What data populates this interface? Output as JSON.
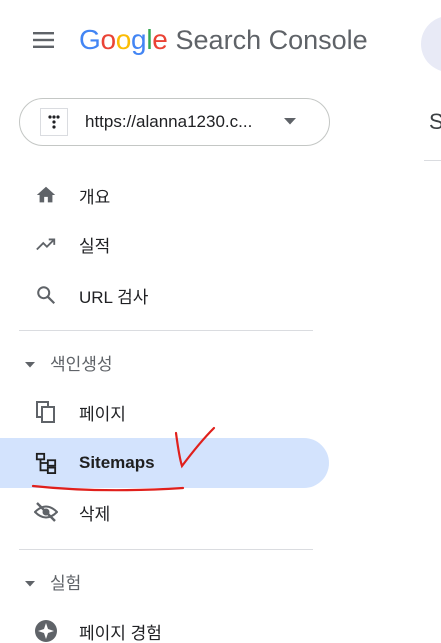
{
  "header": {
    "menu_icon": "hamburger-menu-icon",
    "logo_letters": [
      {
        "ch": "G",
        "color": "#4285F4"
      },
      {
        "ch": "o",
        "color": "#EA4335"
      },
      {
        "ch": "o",
        "color": "#FBBC05"
      },
      {
        "ch": "g",
        "color": "#4285F4"
      },
      {
        "ch": "l",
        "color": "#34A853"
      },
      {
        "ch": "e",
        "color": "#EA4335"
      }
    ],
    "product_name": "Search Console"
  },
  "property_selector": {
    "url": "https://alanna1230.c...",
    "icon": "site-favicon-icon"
  },
  "sidebar": {
    "top_items": [
      {
        "label": "개요",
        "icon": "home-icon"
      },
      {
        "label": "실적",
        "icon": "trending-up-icon"
      },
      {
        "label": "URL 검사",
        "icon": "search-icon"
      }
    ],
    "sections": [
      {
        "title": "색인생성",
        "items": [
          {
            "label": "페이지",
            "icon": "pages-copy-icon"
          },
          {
            "label": "Sitemaps",
            "icon": "sitemap-icon",
            "selected": true
          },
          {
            "label": "삭제",
            "icon": "visibility-off-icon"
          }
        ]
      },
      {
        "title": "실험",
        "items": [
          {
            "label": "페이지 경험",
            "icon": "page-experience-icon"
          }
        ]
      }
    ]
  },
  "main": {
    "title_peek": "S"
  },
  "colors": {
    "selected_bg": "#d3e3fd",
    "icon": "#5f6368",
    "annotation": "#e0201c"
  }
}
